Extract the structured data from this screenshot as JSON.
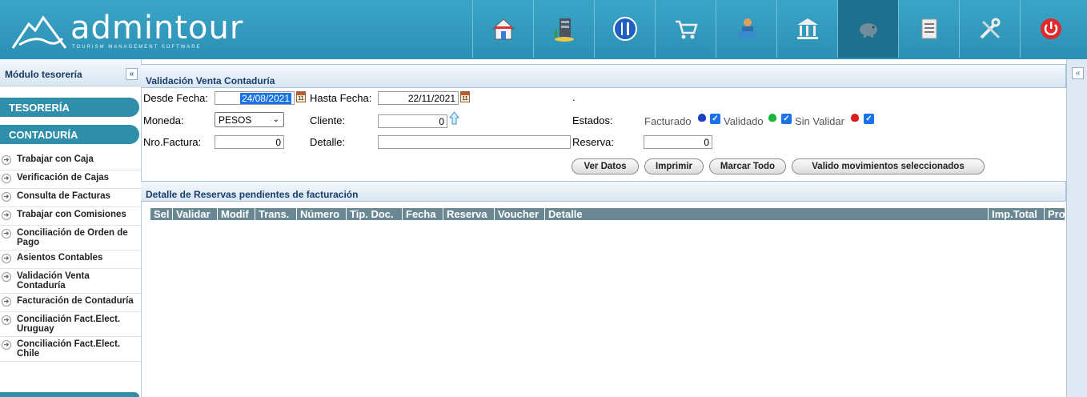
{
  "header": {
    "brand": "admintour",
    "tagline": "TOURISM MANAGEMENT SOFTWARE",
    "nav_icons": [
      "home-icon",
      "building-icon",
      "restaurant-icon",
      "cart-icon",
      "agent-icon",
      "bank-icon",
      "piggy-bank-icon",
      "document-icon",
      "tools-icon",
      "power-icon"
    ],
    "active_icon": "piggy-bank-icon"
  },
  "sidebar": {
    "title": "Módulo tesorería",
    "sections": [
      "TESORERÍA",
      "CONTADURÍA"
    ],
    "items": [
      "Trabajar con Caja",
      "Verificación de Cajas",
      "Consulta de Facturas",
      "Trabajar con Comisiones",
      "Conciliación de Orden de Pago",
      "Asientos Contables",
      "Validación Venta Contaduría",
      "Facturación de Contaduría",
      "Conciliación Fact.Elect. Uruguay",
      "Conciliación Fact.Elect. Chile"
    ]
  },
  "main": {
    "panel_title": "Validación Venta Contaduría",
    "labels": {
      "desde": "Desde Fecha:",
      "hasta": "Hasta Fecha:",
      "moneda": "Moneda:",
      "cliente": "Cliente:",
      "estados": "Estados:",
      "nro_factura": "Nro.Factura:",
      "detalle": "Detalle:",
      "reserva": "Reserva:",
      "facturado": "Facturado",
      "validado": "Validado",
      "sin_validar": "Sin Validar",
      "dot": "."
    },
    "values": {
      "desde": "24/08/2021",
      "hasta": "22/11/2021",
      "moneda": "PESOS",
      "cliente": "0",
      "nro_factura": "0",
      "detalle": "",
      "reserva": "0"
    },
    "buttons": {
      "ver_datos": "Ver Datos",
      "imprimir": "Imprimir",
      "marcar_todo": "Marcar Todo",
      "validar": "Valido movimientos seleccionados"
    },
    "detail_title": "Detalle de Reservas pendientes de facturación",
    "columns": [
      "Sel",
      "Validar",
      "Modif",
      "Trans.",
      "Número",
      "Tip. Doc.",
      "Fecha",
      "Reserva",
      "Voucher",
      "Detalle",
      "Imp.Total",
      "Pro"
    ]
  },
  "colors": {
    "header": "#3aa5c7",
    "section": "#2f8faa",
    "grid_header": "#6a8894",
    "facturado": "#1a3fbf",
    "validado": "#19b53a",
    "sin_validar": "#d61f1f"
  }
}
